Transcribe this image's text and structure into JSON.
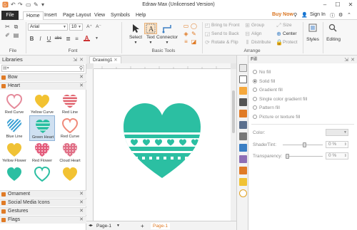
{
  "window": {
    "title": "Edraw Max (Unlicensed Version)",
    "minimize": "–",
    "maximize": "☐",
    "close": "✕"
  },
  "quick_access": [
    "↶",
    "↷",
    "▭",
    "✎",
    "▾"
  ],
  "menu": {
    "tabs": [
      "File",
      "Home",
      "Insert",
      "Page Layout",
      "View",
      "Symbols",
      "Help"
    ],
    "active": "Home",
    "buy_now": "Buy Now",
    "sign_in": "Sign In"
  },
  "ribbon": {
    "file_group": {
      "label": "File"
    },
    "font_group": {
      "label": "Font",
      "font_name": "Arial",
      "font_size": "10",
      "increase": "A⁺",
      "decrease": "A⁻",
      "bold": "B",
      "italic": "I",
      "underline": "U",
      "strike": "abc",
      "bullets": "≣",
      "align": "≡",
      "font_color": "A"
    },
    "tools_group": {
      "label": "Basic Tools",
      "select": "Select",
      "text": "Text",
      "connector": "Connector"
    },
    "arrange_group": {
      "label": "Arrange",
      "bring_to_front": "Bring to Front",
      "send_to_back": "Send to Back",
      "rotate_flip": "Rotate & Flip",
      "group": "Group",
      "align": "Align",
      "distribute": "Distribute",
      "size": "Size",
      "center": "Center",
      "protect": "Protect"
    },
    "styles_label": "Styles",
    "editing_label": "Editing"
  },
  "libraries": {
    "title": "Libraries",
    "search_placeholder": "",
    "bow": "Bow",
    "heart": "Heart",
    "shapes": [
      {
        "name": "Red Curve",
        "color": "#e58b9b",
        "style": "outline"
      },
      {
        "name": "Yellow Curve",
        "color": "#f2c232",
        "style": "solid"
      },
      {
        "name": "Red Line",
        "color": "#e0606b",
        "style": "stripe"
      },
      {
        "name": "Blue Line",
        "color": "#3a9fd3",
        "style": "diag"
      },
      {
        "name": "Green Heart",
        "color": "#2bbfa2",
        "style": "dots"
      },
      {
        "name": "Red Curve",
        "color": "#f08a7a",
        "style": "ring"
      },
      {
        "name": "Yellow Flower",
        "color": "#f0c235",
        "style": "solid"
      },
      {
        "name": "Red Flower",
        "color": "#e35b7b",
        "style": "floral"
      },
      {
        "name": "Cloud Heart",
        "color": "#e06f86",
        "style": "cloud"
      },
      {
        "name": "",
        "color": "#2bbfa2",
        "style": "solid"
      },
      {
        "name": "",
        "color": "#2bbfa2",
        "style": "outline"
      },
      {
        "name": "",
        "color": "#f2c232",
        "style": "solid"
      }
    ],
    "categories": [
      "Ornament",
      "Social Media Icons",
      "Gestures",
      "Flags"
    ]
  },
  "canvas": {
    "doc_tab": "Drawing1",
    "page_tab": "Page-1",
    "add_page": "+",
    "current_page": "Page-1",
    "heart_color": "#2bbfa2"
  },
  "fill_panel": {
    "title": "Fill",
    "options": [
      "No fill",
      "Solid fill",
      "Gradient fill",
      "Single color gradient fill",
      "Pattern fill",
      "Picture or texture fill"
    ],
    "selected": "Solid fill",
    "color_label": "Color:",
    "shade_label": "Shade/Tint:",
    "shade_value": "0 %",
    "transparency_label": "Transparency:",
    "transparency_value": "0 %"
  },
  "colors": {
    "accent_orange": "#e07b26",
    "teal": "#2bbfa2"
  }
}
